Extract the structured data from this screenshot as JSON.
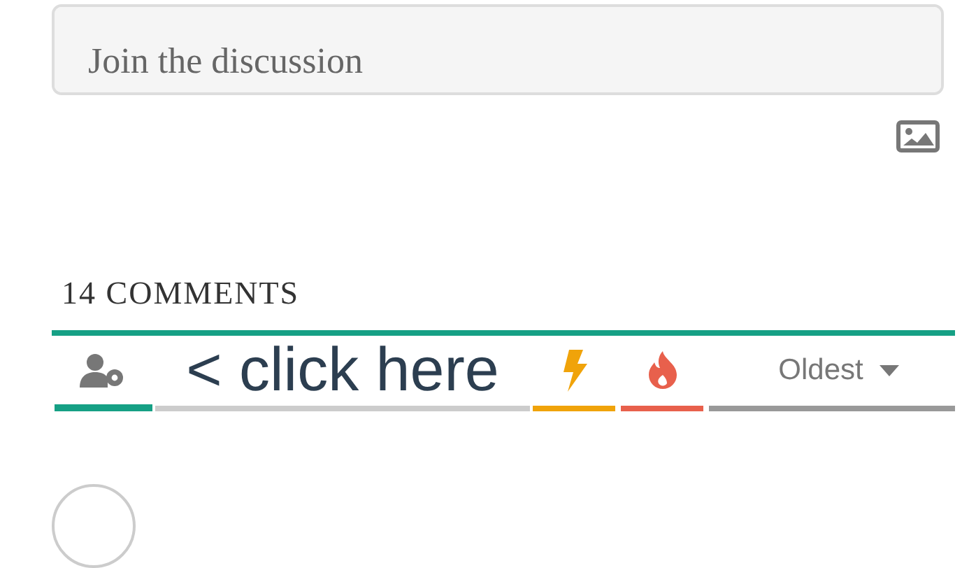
{
  "composer": {
    "placeholder": "Join the discussion"
  },
  "comment_count": "14 COMMENTS",
  "tabs": [
    {
      "kind": "people",
      "color": "#16a085",
      "selected": true
    },
    {
      "kind": "bolt",
      "color": "#f0a30a",
      "selected": false
    },
    {
      "kind": "flame",
      "color": "#e8604c",
      "selected": false
    }
  ],
  "annotation": "< click here",
  "sort": {
    "label": "Oldest"
  }
}
